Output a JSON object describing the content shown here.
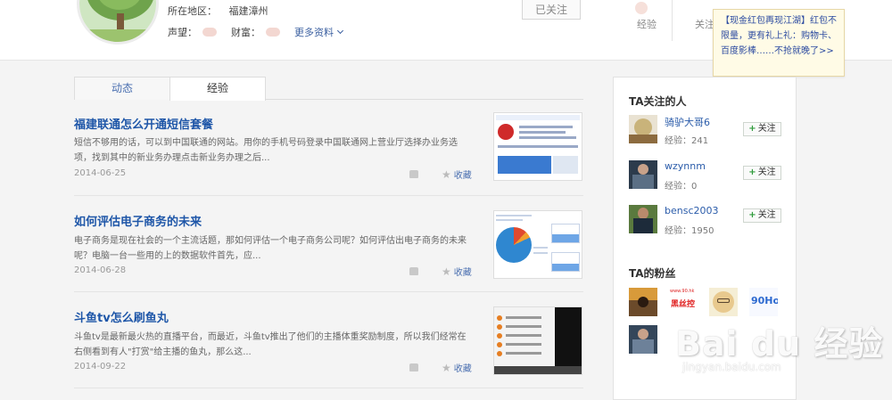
{
  "profile": {
    "region_label": "所在地区：",
    "region_value": "福建漳州",
    "reputation_label": "声望：",
    "wealth_label": "财富：",
    "more_info": "更多资料",
    "followed_button": "已关注",
    "top_tabs": [
      "经验",
      "关注"
    ]
  },
  "tooltip": {
    "text": "【现金红包再现江湖】红包不限量，更有礼上礼：购物卡、百度影棒……不抢就晚了>>"
  },
  "tabs": [
    {
      "label": "动态",
      "active": false
    },
    {
      "label": "经验",
      "active": true
    }
  ],
  "articles": [
    {
      "title": "福建联通怎么开通短信套餐",
      "excerpt": "短信不够用的话，可以到中国联通的网站。用你的手机号码登录中国联通网上营业厅选择办业务选项，找到其中的新业务办理点击新业务办理之后...",
      "date": "2014-06-25",
      "collect": "收藏"
    },
    {
      "title": "如何评估电子商务的未来",
      "excerpt": "电子商务是现在社会的一个主流话题，那如何评估一个电子商务公司呢？如何评估出电子商务的未来呢？电脑一台一些用的上的数据软件首先，应...",
      "date": "2014-06-28",
      "collect": "收藏"
    },
    {
      "title": "斗鱼tv怎么刷鱼丸",
      "excerpt": "斗鱼tv是最新最火热的直播平台，而最近，斗鱼tv推出了他们的主播体重奖励制度，所以我们经常在右侧看到有人\"打赏\"给主播的鱼丸，那么这...",
      "date": "2014-09-22",
      "collect": "收藏"
    }
  ],
  "sidebar": {
    "following_title": "TA关注的人",
    "following": [
      {
        "name": "骑驴大哥6",
        "exp": "经验：241",
        "button": "关注"
      },
      {
        "name": "wzynnm",
        "exp": "经验：0",
        "button": "关注"
      },
      {
        "name": "bensc2003",
        "exp": "经验：1950",
        "button": "关注"
      }
    ],
    "fans_title": "TA的粉丝",
    "fan_thumb_texts": [
      "www.90.hk",
      "黑丝控",
      "90Ho"
    ]
  },
  "watermark": {
    "main": "Bai du 经验",
    "sub": "jingyan.baidu.com"
  },
  "colors": {
    "link_blue": "#1e56a8",
    "follow_plus": "#2e9a3a",
    "tooltip_bg": "#fffbe6"
  }
}
